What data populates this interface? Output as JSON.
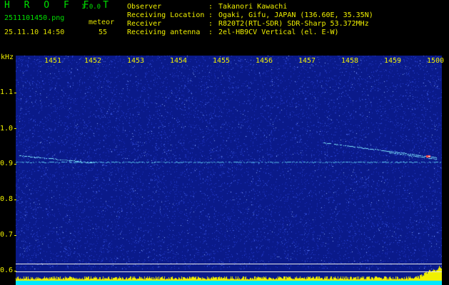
{
  "header": {
    "app_title": "H R O F F T",
    "app_version": "1.0.0",
    "file_name": "2511101450.png",
    "mode_label": "meteor",
    "timestamp": "25.11.10 14:50",
    "count": "55",
    "info": [
      {
        "key": "Observer",
        "value": "Takanori Kawachi"
      },
      {
        "key": "Receiving Location",
        "value": "Ogaki, Gifu, JAPAN (136.60E, 35.35N)"
      },
      {
        "key": "Receiver",
        "value": "R820T2(RTL-SDR) SDR-Sharp 53.372MHz"
      },
      {
        "key": "Receiving antenna",
        "value": "2el-HB9CV Vertical (el. E-W)"
      }
    ],
    "separator": ":"
  },
  "axes": {
    "y_unit": "kHz",
    "x_ticks": [
      "1451",
      "1452",
      "1453",
      "1454",
      "1455",
      "1456",
      "1457",
      "1458",
      "1459",
      "1500"
    ],
    "y_ticks": [
      "1.1",
      "1.0",
      "0.9",
      "0.8",
      "0.7",
      "0.6"
    ]
  },
  "colors": {
    "background": "#0a1a8a",
    "noise": "#2a45d8",
    "carrier": "#7fe6ff",
    "meteor_head": "#ff4040",
    "amplitude_fill": "#f0f000",
    "baseline": "#00e8ff",
    "text_yellow": "#f0f000",
    "text_green": "#00e000"
  }
}
